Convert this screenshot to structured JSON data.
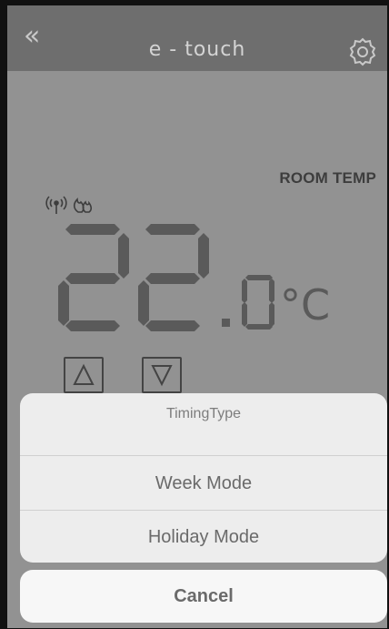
{
  "nav": {
    "back_icon": "double-chevron-left-icon",
    "title": "e - touch",
    "settings_icon": "gear-icon"
  },
  "display": {
    "room_temp_label": "ROOM TEMP",
    "status_icons": [
      "wireless-signal-icon",
      "flame-icon"
    ],
    "temperature_integer": "22",
    "temperature_decimal_separator": ".",
    "temperature_decimal": "0",
    "temperature_unit": "°C",
    "up_button_icon": "triangle-up-icon",
    "down_button_icon": "triangle-down-icon"
  },
  "action_sheet": {
    "title": "TimingType",
    "options": [
      {
        "label": "Week Mode"
      },
      {
        "label": "Holiday Mode"
      }
    ],
    "cancel_label": "Cancel"
  },
  "colors": {
    "overlay_background": "#929292",
    "navbar": "#6e6e6e",
    "sheet_background": "#ededed",
    "segment_digit": "#5a5a5a"
  }
}
